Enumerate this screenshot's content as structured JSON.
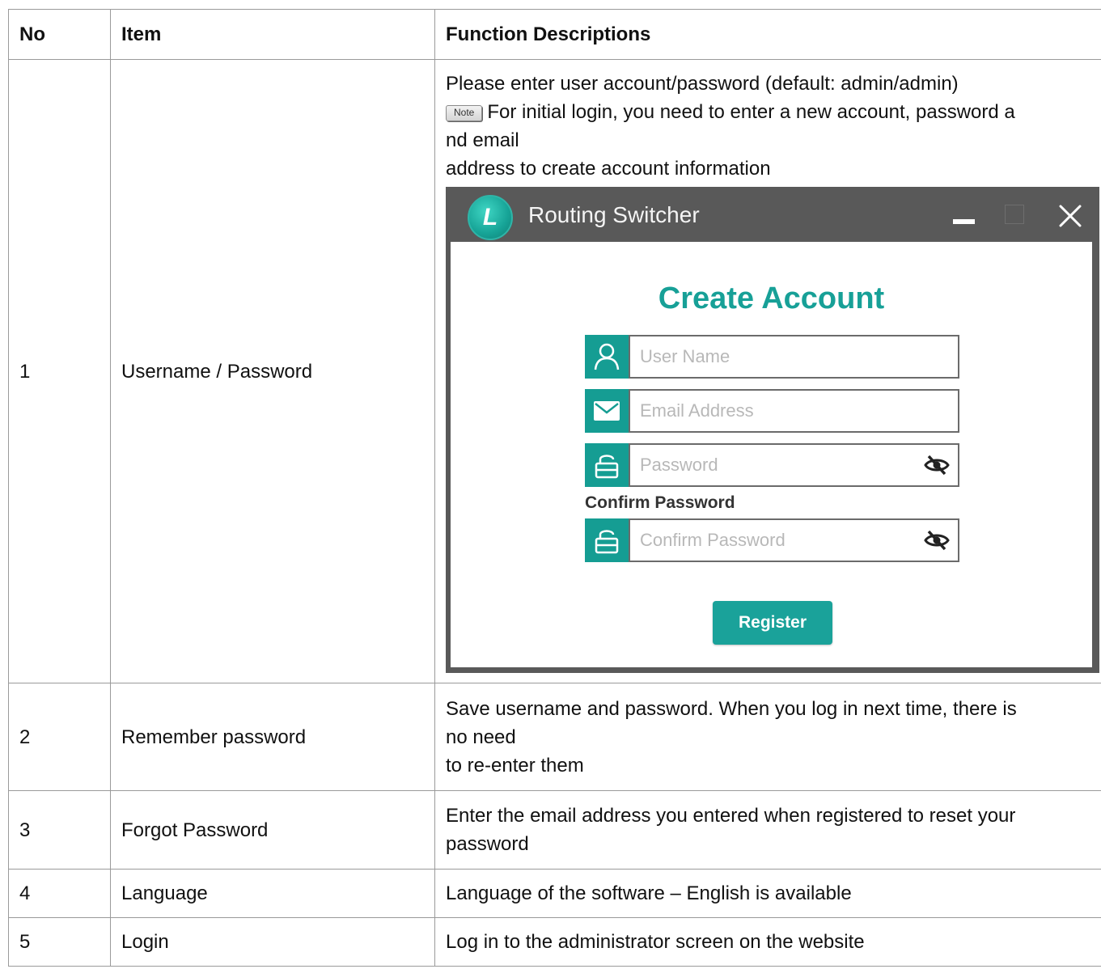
{
  "table": {
    "headers": [
      "No",
      "Item",
      "Function Descriptions"
    ],
    "rows": [
      {
        "no": "1",
        "item": "Username / Password",
        "desc_lines": [
          "Please enter user account/password (default: admin/admin)"
        ],
        "note_tag": "Note",
        "note_lines": [
          "For initial login, you need to enter a new account, password a",
          "nd email",
          "address to create account information"
        ]
      },
      {
        "no": "2",
        "item": "Remember password",
        "desc_lines": [
          "Save username and password. When you log in next time, there is",
          "no need",
          "to re-enter them"
        ]
      },
      {
        "no": "3",
        "item": "Forgot Password",
        "desc_lines": [
          "Enter the email address you entered when registered to reset your",
          "password"
        ]
      },
      {
        "no": "4",
        "item": "Language",
        "desc_lines": [
          "Language of the software – English is available"
        ]
      },
      {
        "no": "5",
        "item": "Login",
        "desc_lines": [
          "Log in to the administrator screen on the website"
        ]
      }
    ]
  },
  "app": {
    "title": "Routing Switcher",
    "logo_letter": "L",
    "heading": "Create Account",
    "fields": {
      "username_placeholder": "User Name",
      "email_placeholder": "Email Address",
      "password_placeholder": "Password",
      "confirm_label": "Confirm Password",
      "confirm_placeholder": "Confirm Password"
    },
    "register_label": "Register",
    "icons": [
      "user-icon",
      "mail-icon",
      "lock-icon",
      "eye-slash-icon",
      "minimize-icon",
      "maximize-icon",
      "close-icon"
    ],
    "colors": {
      "accent": "#159d93",
      "title_bar": "#595959"
    }
  }
}
